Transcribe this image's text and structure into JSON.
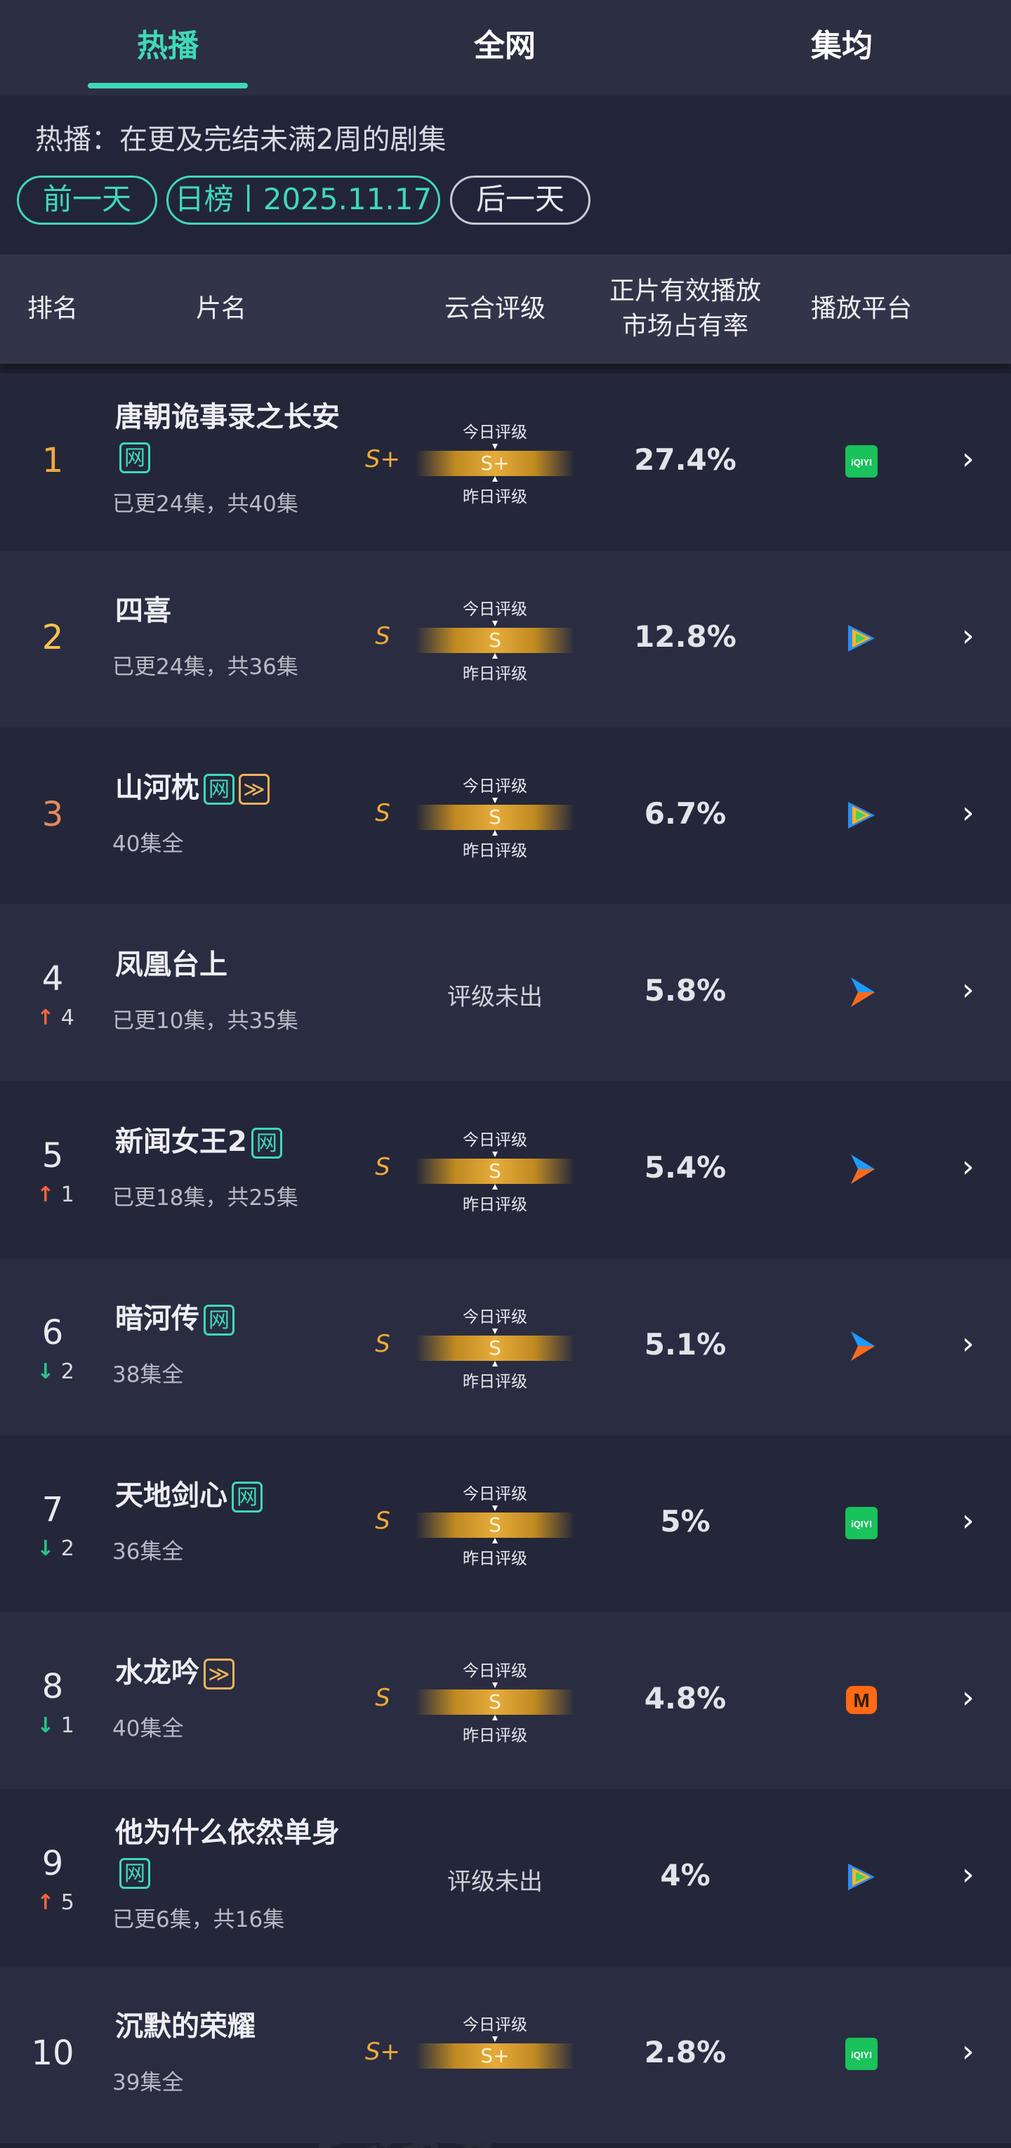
{
  "tabs": [
    {
      "label": "热播",
      "active": true
    },
    {
      "label": "全网",
      "active": false
    },
    {
      "label": "集均",
      "active": false
    }
  ],
  "note": "热播：在更及完结未满2周的剧集",
  "date_nav": {
    "prev": "前一天",
    "current": "日榜丨2025.11.17",
    "next": "后一天"
  },
  "columns": {
    "rank": "排名",
    "title": "片名",
    "grade": "云合评级",
    "share_line1": "正片有效播放",
    "share_line2": "市场占有率",
    "platform": "播放平台"
  },
  "grade_labels": {
    "today": "今日评级",
    "yesterday": "昨日评级"
  },
  "watermarks": [
    "云合数据",
    "ENLIGHTENT",
    "@ 5997271"
  ],
  "rows": [
    {
      "rank": "1",
      "title": "唐朝诡事录之长安",
      "badges": [
        "net"
      ],
      "episodes": "已更24集，共40集",
      "trend_dir": "",
      "trend_value": "",
      "grade_left": "S+",
      "grade_today": "S+",
      "show_grade": true,
      "show_yesterday": true,
      "share": "27.4%",
      "platform": "iqiyi"
    },
    {
      "rank": "2",
      "title": "四喜",
      "badges": [],
      "episodes": "已更24集，共36集",
      "trend_dir": "",
      "trend_value": "",
      "grade_left": "S",
      "grade_today": "S",
      "show_grade": true,
      "show_yesterday": true,
      "share": "12.8%",
      "platform": "tencent"
    },
    {
      "rank": "3",
      "title": "山河枕",
      "badges": [
        "net",
        "fwd"
      ],
      "episodes": "40集全",
      "trend_dir": "",
      "trend_value": "",
      "grade_left": "S",
      "grade_today": "S",
      "show_grade": true,
      "show_yesterday": true,
      "share": "6.7%",
      "platform": "tencent"
    },
    {
      "rank": "4",
      "title": "凤凰台上",
      "badges": [],
      "episodes": "已更10集，共35集",
      "trend_dir": "up",
      "trend_value": "4",
      "grade_left": "",
      "grade_today": "",
      "show_grade": false,
      "show_yesterday": false,
      "grade_none": "评级未出",
      "share": "5.8%",
      "platform": "youku"
    },
    {
      "rank": "5",
      "title": "新闻女王2",
      "badges": [
        "net"
      ],
      "episodes": "已更18集，共25集",
      "trend_dir": "up",
      "trend_value": "1",
      "grade_left": "S",
      "grade_today": "S",
      "show_grade": true,
      "show_yesterday": true,
      "share": "5.4%",
      "platform": "youku"
    },
    {
      "rank": "6",
      "title": "暗河传",
      "badges": [
        "net"
      ],
      "episodes": "38集全",
      "trend_dir": "down",
      "trend_value": "2",
      "grade_left": "S",
      "grade_today": "S",
      "show_grade": true,
      "show_yesterday": true,
      "share": "5.1%",
      "platform": "youku"
    },
    {
      "rank": "7",
      "title": "天地剑心",
      "badges": [
        "net"
      ],
      "episodes": "36集全",
      "trend_dir": "down",
      "trend_value": "2",
      "grade_left": "S",
      "grade_today": "S",
      "show_grade": true,
      "show_yesterday": true,
      "share": "5%",
      "platform": "iqiyi"
    },
    {
      "rank": "8",
      "title": "水龙吟",
      "badges": [
        "fwd"
      ],
      "episodes": "40集全",
      "trend_dir": "down",
      "trend_value": "1",
      "grade_left": "S",
      "grade_today": "S",
      "show_grade": true,
      "show_yesterday": true,
      "share": "4.8%",
      "platform": "mango"
    },
    {
      "rank": "9",
      "title": "他为什么依然单身",
      "badges": [
        "net"
      ],
      "episodes": "已更6集，共16集",
      "trend_dir": "up",
      "trend_value": "5",
      "grade_left": "",
      "grade_today": "",
      "show_grade": false,
      "show_yesterday": false,
      "grade_none": "评级未出",
      "share": "4%",
      "platform": "tencent"
    },
    {
      "rank": "10",
      "title": "沉默的荣耀",
      "badges": [],
      "episodes": "39集全",
      "trend_dir": "",
      "trend_value": "",
      "grade_left": "S+",
      "grade_today": "S+",
      "show_grade": true,
      "show_yesterday": false,
      "share": "2.8%",
      "platform": "iqiyi"
    }
  ],
  "badge_text": {
    "net": "网",
    "fwd": "≫"
  },
  "platform_names": {
    "iqiyi": "iQIYI",
    "tencent": "腾讯视频",
    "youku": "优酷",
    "mango": "芒果TV"
  },
  "colors": {
    "accent": "#3fd9b7",
    "rank1": "#f2a93b",
    "rank2": "#f4c24f",
    "rank3": "#e38a5a",
    "up": "#f0653c",
    "down": "#2bc48d",
    "grade": "#f1a93a"
  }
}
